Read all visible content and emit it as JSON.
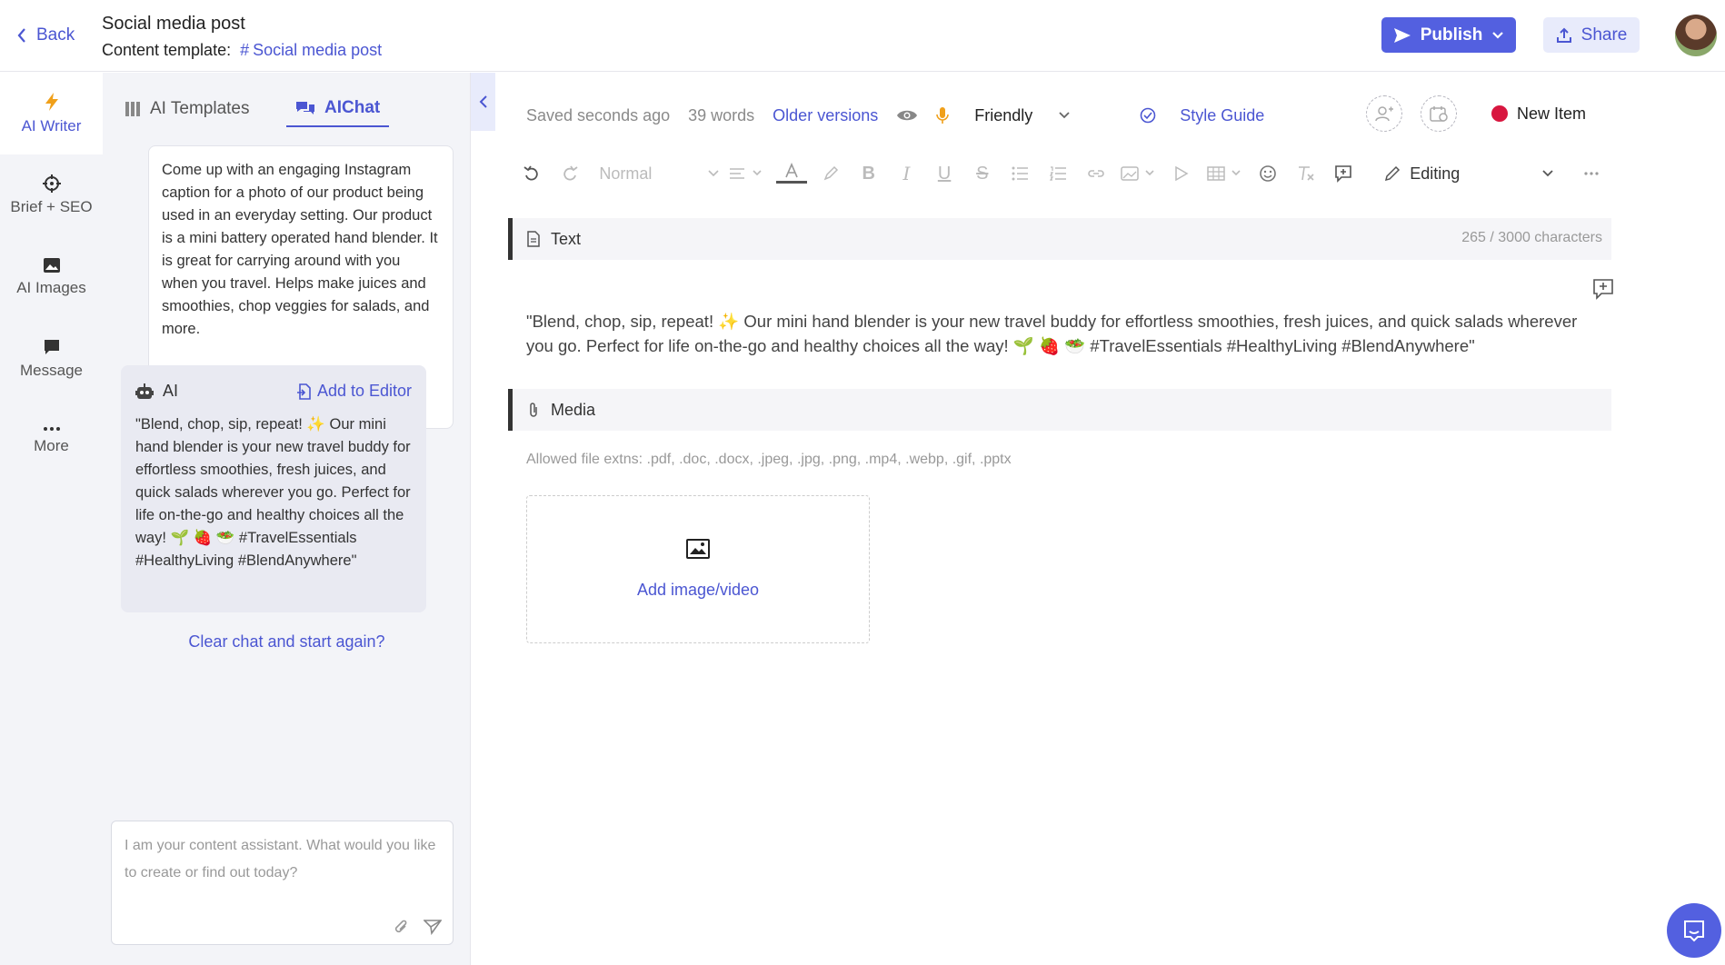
{
  "header": {
    "back_label": "Back",
    "title": "Social media post",
    "template_label": "Content template:",
    "template_name": "Social media post",
    "publish_label": "Publish",
    "share_label": "Share"
  },
  "rail": {
    "items": [
      {
        "label": "AI Writer",
        "icon": "lightning-icon"
      },
      {
        "label": "Brief + SEO",
        "icon": "crosshair-icon"
      },
      {
        "label": "AI Images",
        "icon": "image-icon"
      },
      {
        "label": "Message",
        "icon": "message-icon"
      },
      {
        "label": "More",
        "icon": "more-icon"
      }
    ]
  },
  "chat": {
    "tabs": [
      {
        "label": "AI Templates",
        "icon": "templates-icon"
      },
      {
        "label": "AIChat",
        "icon": "chat-icon"
      }
    ],
    "user_message": "Come up with an engaging Instagram caption for a photo of our product being used in an everyday setting. Our product is a mini battery operated hand blender. It is great for carrying around with you when you travel. Helps make juices and smoothies, chop veggies for salads, and more.",
    "ai_label": "AI",
    "add_to_editor": "Add to Editor",
    "ai_message": "\"Blend, chop, sip, repeat! ✨ Our mini hand blender is your new travel buddy for effortless smoothies, fresh juices, and quick salads wherever you go. Perfect for life on-the-go and healthy choices all the way! 🌱 🍓 🥗 #TravelEssentials #HealthyLiving #BlendAnywhere\"",
    "clear_label": "Clear chat and start again?",
    "input_placeholder": "I am your content assistant. What would you like to create or find out today?"
  },
  "editor": {
    "saved": "Saved seconds ago",
    "words": "39 words",
    "older_versions": "Older versions",
    "tone": "Friendly",
    "style_guide": "Style Guide",
    "new_item": "New Item",
    "format_select": "Normal",
    "mode": "Editing",
    "text_section": "Text",
    "char_counter": "265 / 3000 characters",
    "body": "\"Blend, chop, sip, repeat! ✨ Our mini hand blender is your new travel buddy for effortless smoothies, fresh juices, and quick salads wherever you go. Perfect for life on-the-go and healthy choices all the way! 🌱 🍓 🥗 #TravelEssentials #HealthyLiving #BlendAnywhere\"",
    "media_section": "Media",
    "allowed_ext": "Allowed file extns: .pdf, .doc, .docx, .jpeg, .jpg, .png, .mp4, .webp, .gif, .pptx",
    "add_media": "Add image/video"
  },
  "colors": {
    "accent": "#5360e0",
    "link": "#4b56d2",
    "status_dot": "#d8163f",
    "panel_bg": "#f3f4f8"
  }
}
